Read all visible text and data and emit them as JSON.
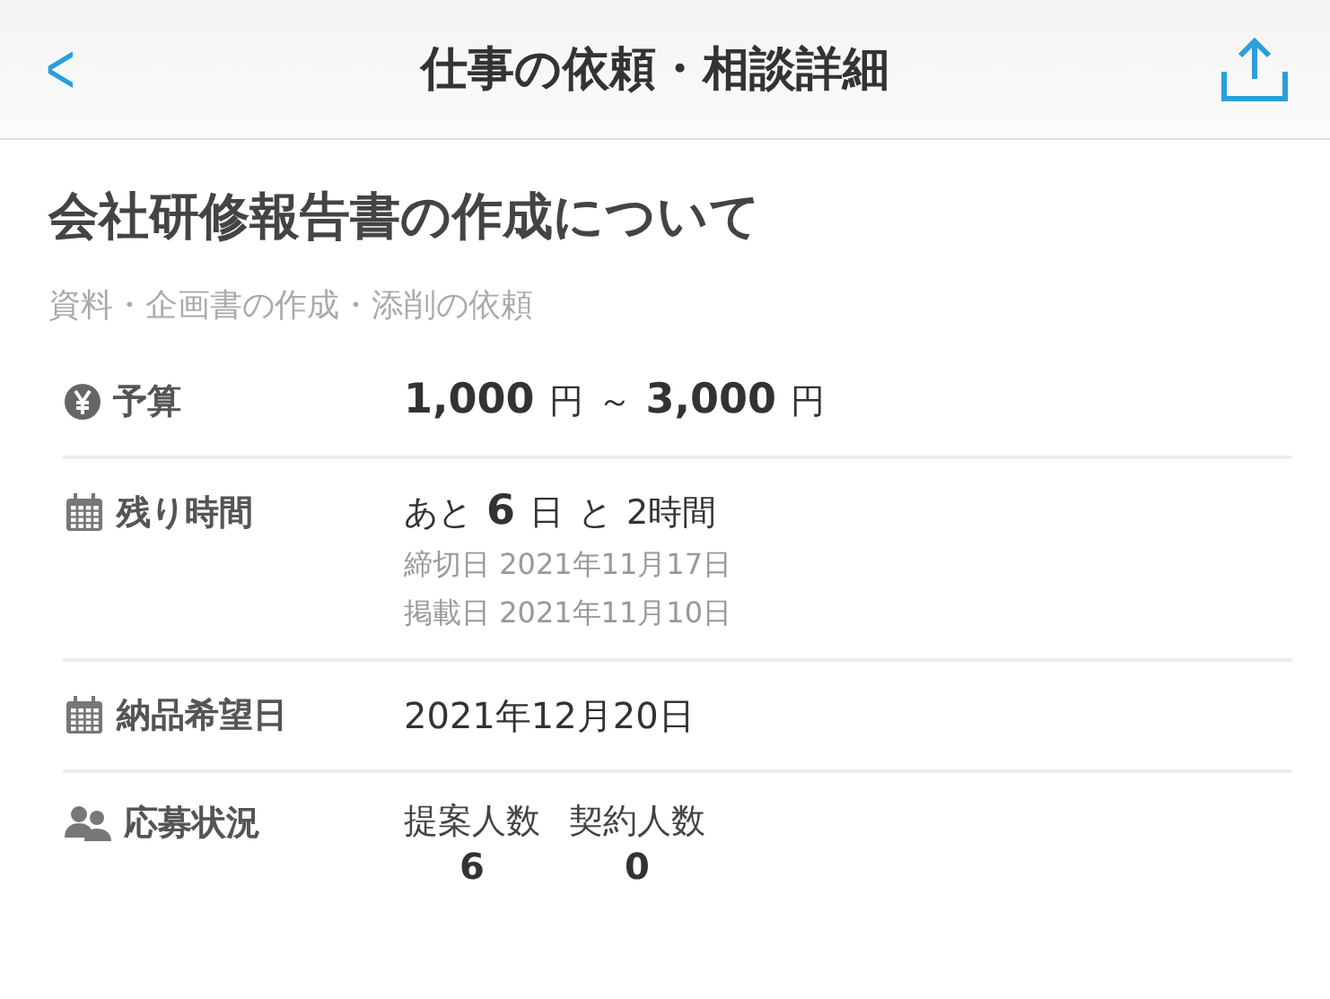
{
  "header": {
    "back": "<",
    "title": "仕事の依頼・相談詳細"
  },
  "job": {
    "title": "会社研修報告書の作成について",
    "category": "資料・企画書の作成・添削の依頼"
  },
  "details": [
    {
      "kind": "budget",
      "label": "予算",
      "parts": [
        {
          "text": "1,000",
          "large": true
        },
        {
          "text": "円",
          "large": false
        },
        {
          "text": "～",
          "large": false
        },
        {
          "text": "3,000",
          "large": true
        },
        {
          "text": "円",
          "large": false
        }
      ]
    },
    {
      "kind": "remaining",
      "label": "残り時間",
      "parts": [
        {
          "text": "あと",
          "large": false
        },
        {
          "text": "6",
          "large": true
        },
        {
          "text": "日",
          "large": false
        },
        {
          "text": "と",
          "large": false
        },
        {
          "text": "2時間",
          "large": false
        }
      ],
      "notes": [
        "締切日 2021年11月17日",
        "掲載日 2021年11月10日"
      ]
    },
    {
      "kind": "date",
      "label": "納品希望日",
      "value": "2021年12月20日"
    },
    {
      "kind": "applicants",
      "label": "応募状況",
      "counts": [
        {
          "label": "提案人数",
          "count": "6"
        },
        {
          "label": "契約人数",
          "count": "0"
        }
      ]
    }
  ]
}
